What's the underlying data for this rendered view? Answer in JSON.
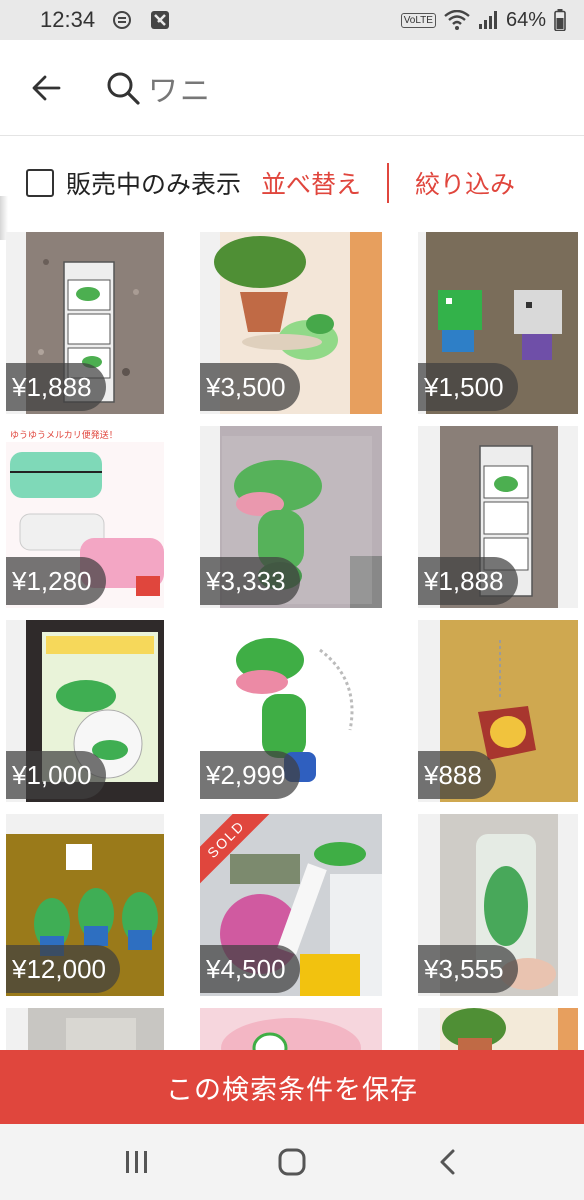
{
  "status_bar": {
    "time": "12:34",
    "network_label": "VoLTE",
    "battery": "64%",
    "icons": [
      "data-saver-icon",
      "app-notification-icon",
      "volte-icon",
      "wifi-icon",
      "signal-icon",
      "battery-icon"
    ]
  },
  "search": {
    "query": "ワニ",
    "back_icon": "arrow-left-icon",
    "search_icon": "search-icon"
  },
  "filters": {
    "on_sale_only_label": "販売中のみ表示",
    "on_sale_only_checked": false,
    "sort_label": "並べ替え",
    "filter_label": "絞り込み"
  },
  "items": [
    {
      "price": "¥1,888",
      "sold": false
    },
    {
      "price": "¥3,500",
      "sold": false
    },
    {
      "price": "¥1,500",
      "sold": false
    },
    {
      "price": "¥1,280",
      "sold": false
    },
    {
      "price": "¥3,333",
      "sold": false
    },
    {
      "price": "¥1,888",
      "sold": false
    },
    {
      "price": "¥1,000",
      "sold": false
    },
    {
      "price": "¥2,999",
      "sold": false
    },
    {
      "price": "¥888",
      "sold": false
    },
    {
      "price": "¥12,000",
      "sold": false
    },
    {
      "price": "¥4,500",
      "sold": true,
      "sold_label": "SOLD"
    },
    {
      "price": "¥3,555",
      "sold": false
    },
    {
      "price": "",
      "sold": false
    },
    {
      "price": "",
      "sold": false
    },
    {
      "price": "",
      "sold": false
    }
  ],
  "save_search_label": "この検索条件を保存",
  "nav": {
    "icons": [
      "recent-apps-icon",
      "home-icon",
      "back-icon"
    ]
  },
  "colors": {
    "accent": "#e0463d",
    "price_badge": "#404040"
  }
}
